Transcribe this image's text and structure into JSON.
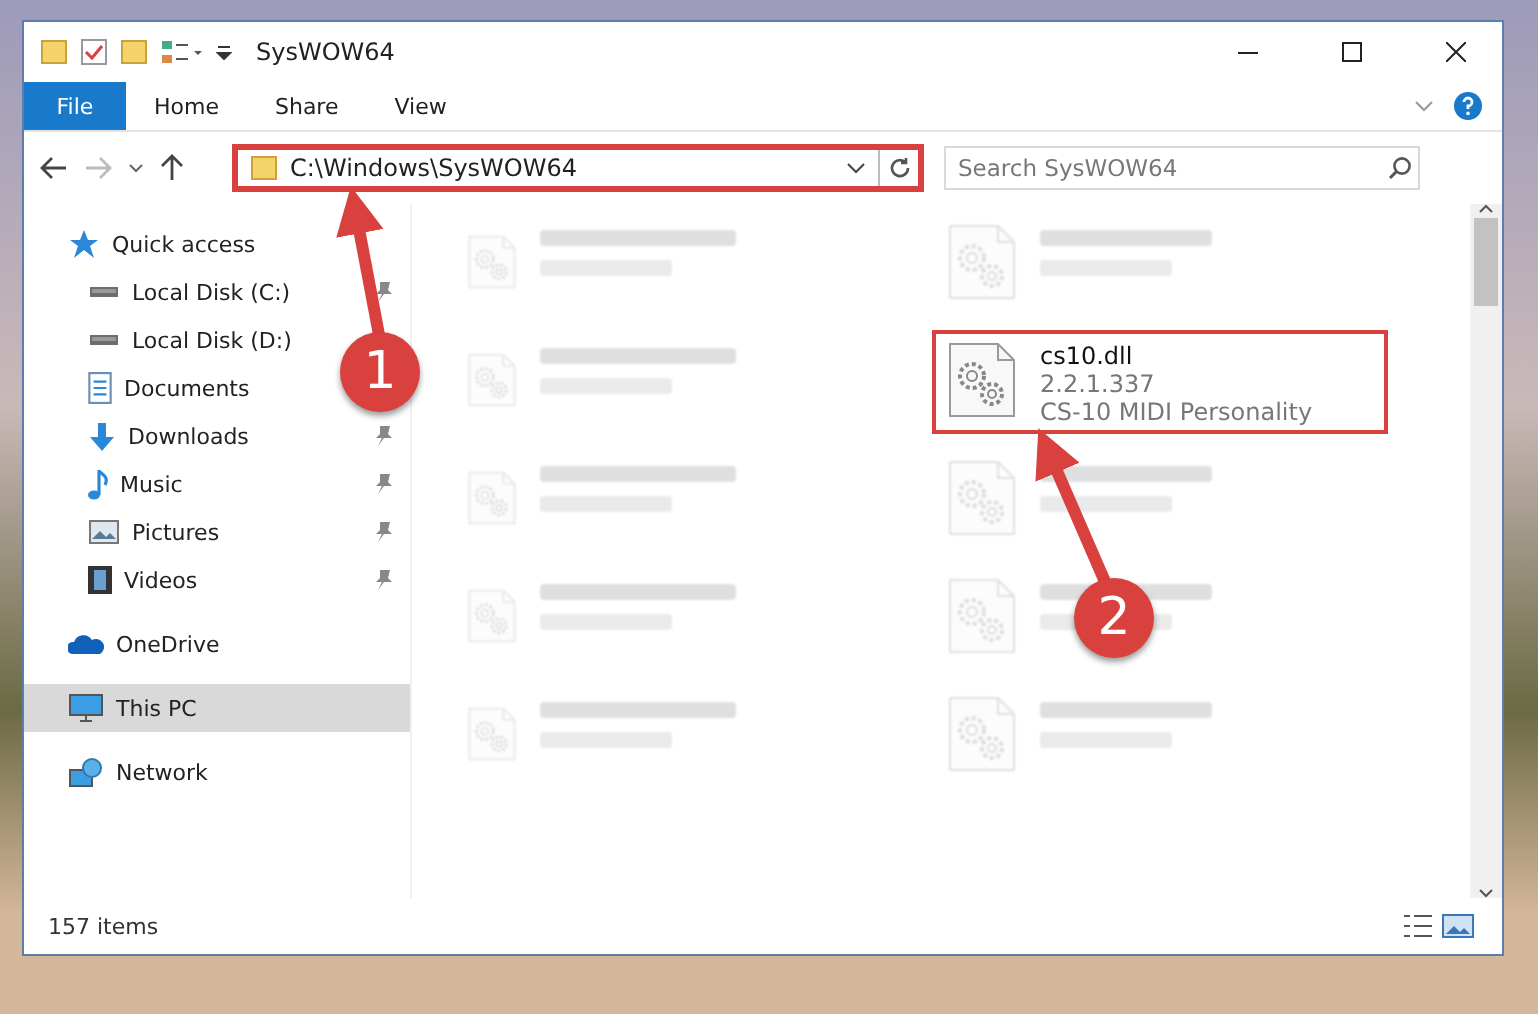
{
  "window": {
    "title": "SysWOW64"
  },
  "ribbon": {
    "tabs": [
      {
        "label": "File",
        "selected": true
      },
      {
        "label": "Home",
        "selected": false
      },
      {
        "label": "Share",
        "selected": false
      },
      {
        "label": "View",
        "selected": false
      }
    ]
  },
  "address_bar": {
    "path": "C:\\Windows\\SysWOW64",
    "highlighted": true
  },
  "search": {
    "placeholder": "Search SysWOW64"
  },
  "sidebar": {
    "items": [
      {
        "label": "Quick access",
        "kind": "star",
        "selected": false,
        "children": [
          {
            "label": "Local Disk (C:)",
            "kind": "drive",
            "pinned": true,
            "selected": false
          },
          {
            "label": "Local Disk (D:)",
            "kind": "drive",
            "pinned": false,
            "selected": false
          },
          {
            "label": "Documents",
            "kind": "document",
            "pinned": false,
            "selected": false
          },
          {
            "label": "Downloads",
            "kind": "download",
            "pinned": true,
            "selected": false
          },
          {
            "label": "Music",
            "kind": "music",
            "pinned": true,
            "selected": false
          },
          {
            "label": "Pictures",
            "kind": "picture",
            "pinned": true,
            "selected": false
          },
          {
            "label": "Videos",
            "kind": "video",
            "pinned": true,
            "selected": false
          }
        ]
      },
      {
        "label": "OneDrive",
        "kind": "cloud",
        "selected": false
      },
      {
        "label": "This PC",
        "kind": "computer",
        "selected": true
      },
      {
        "label": "Network",
        "kind": "network",
        "selected": false
      }
    ]
  },
  "files": [
    {
      "dimmed": true,
      "highlighted": false
    },
    {
      "dimmed": true,
      "highlighted": false
    },
    {
      "dimmed": true,
      "highlighted": false
    },
    {
      "name": "cs10.dll",
      "details": [
        "2.2.1.337",
        "CS-10 MIDI Personality"
      ],
      "dimmed": false,
      "highlighted": true
    },
    {
      "dimmed": true,
      "highlighted": false
    },
    {
      "dimmed": true,
      "highlighted": false
    },
    {
      "dimmed": true,
      "highlighted": false
    },
    {
      "dimmed": true,
      "highlighted": false
    },
    {
      "dimmed": true,
      "highlighted": false
    },
    {
      "dimmed": true,
      "highlighted": false
    }
  ],
  "callouts": [
    {
      "label": "1"
    },
    {
      "label": "2"
    }
  ],
  "status_bar": {
    "item_count": "157 items"
  }
}
